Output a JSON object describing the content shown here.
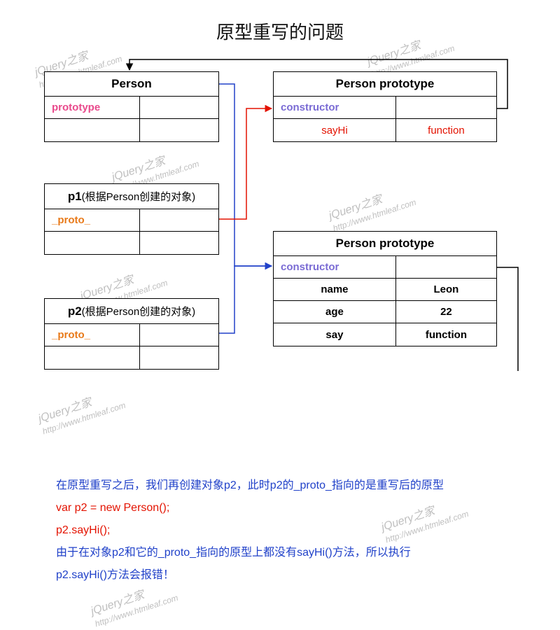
{
  "title": "原型重写的问题",
  "watermark": {
    "brand": "jQuery之家",
    "url": "http://www.htmleaf.com"
  },
  "boxes": {
    "person": {
      "header": "Person",
      "rows": [
        [
          "prototype",
          ""
        ],
        [
          "",
          ""
        ]
      ]
    },
    "proto1": {
      "header": "Person prototype",
      "rows": [
        [
          "constructor",
          ""
        ],
        [
          "sayHi",
          "function"
        ]
      ]
    },
    "p1": {
      "header_prefix": "p1",
      "header_sub": "(根据Person创建的对象)",
      "rows": [
        [
          "_proto_",
          ""
        ],
        [
          "",
          ""
        ]
      ]
    },
    "proto2": {
      "header": "Person prototype",
      "rows": [
        [
          "constructor",
          ""
        ],
        [
          "name",
          "Leon"
        ],
        [
          "age",
          "22"
        ],
        [
          "say",
          "function"
        ]
      ]
    },
    "p2": {
      "header_prefix": "p2",
      "header_sub": "(根据Person创建的对象)",
      "rows": [
        [
          "_proto_",
          ""
        ],
        [
          "",
          ""
        ]
      ]
    }
  },
  "notes": {
    "l1": "在原型重写之后，我们再创建对象p2，此时p2的_proto_指向的是重写后的原型",
    "l2": "var p2 = new Person();",
    "l3": "p2.sayHi();",
    "l4": "由于在对象p2和它的_proto_指向的原型上都没有sayHi()方法，所以执行",
    "l5": "p2.sayHi()方法会报错！"
  }
}
